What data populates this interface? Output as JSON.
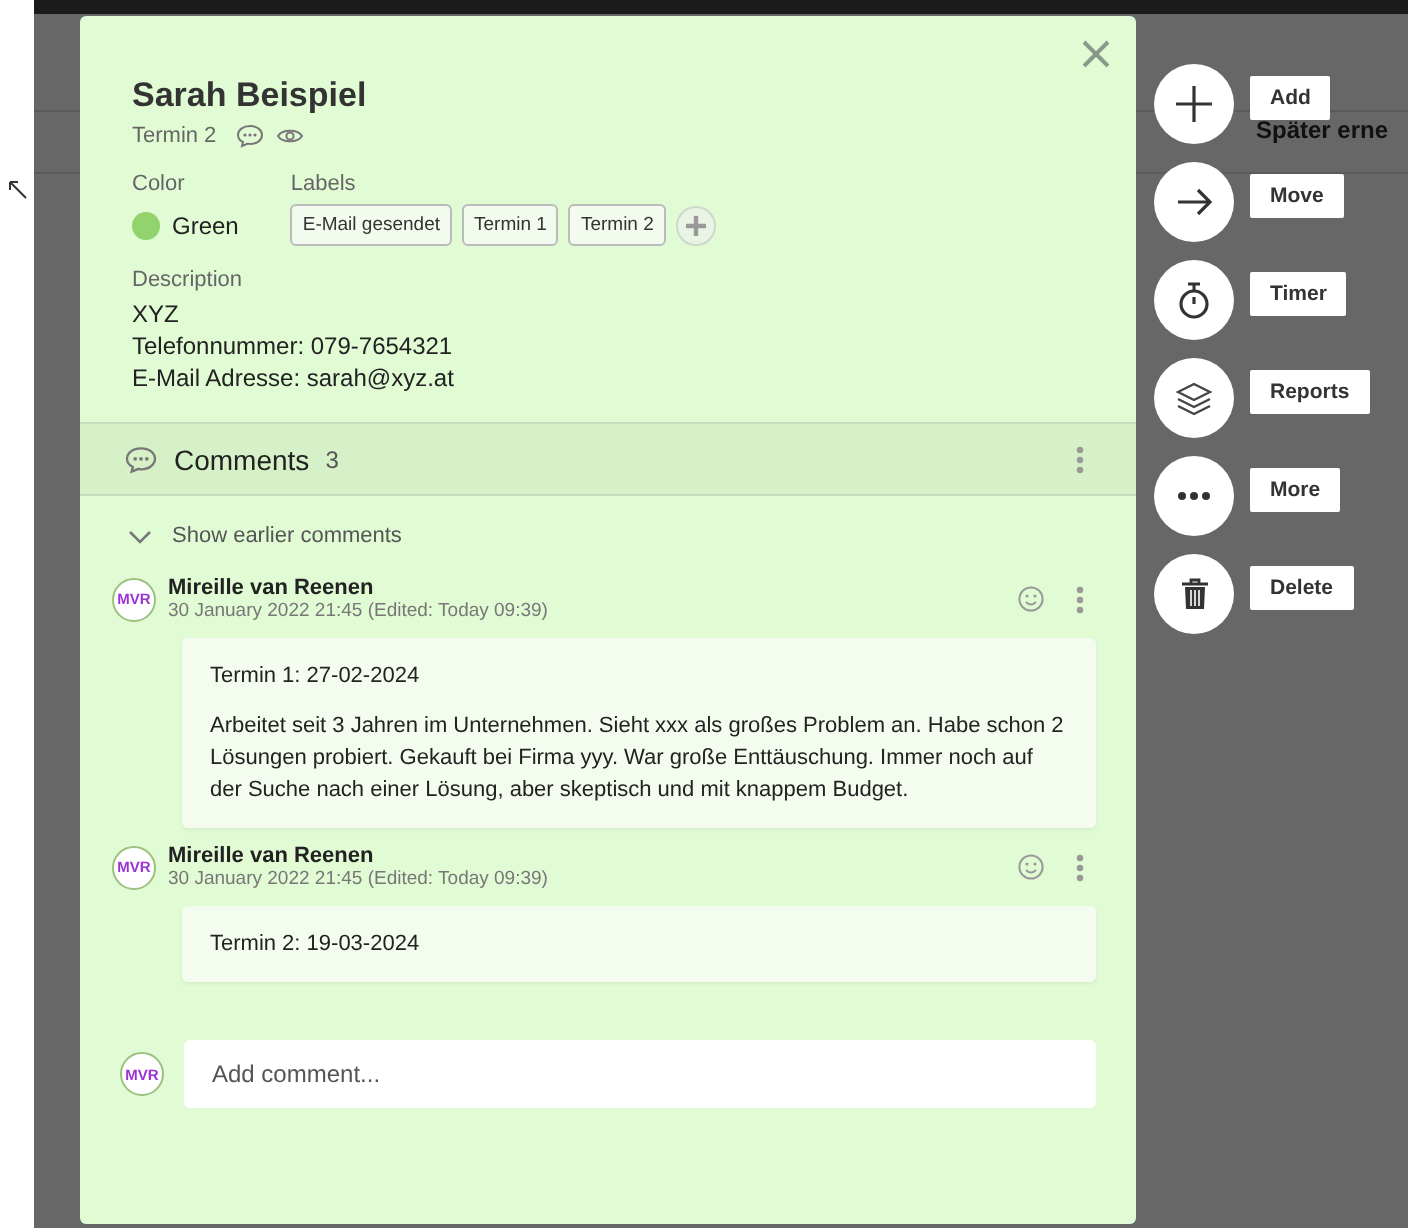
{
  "backdrop": {
    "text": "Später erne"
  },
  "card": {
    "title": "Sarah Beispiel",
    "list": "Termin 2",
    "color_label": "Color",
    "color": {
      "name": "Green",
      "color": "#92d36e"
    },
    "labels_label": "Labels",
    "labels": [
      "E-Mail gesendet",
      "Termin 1",
      "Termin 2"
    ],
    "description_label": "Description",
    "description": [
      "XYZ",
      "Telefonnummer: 079-7654321",
      "E-Mail Adresse: sarah@xyz.at"
    ]
  },
  "comments": {
    "title": "Comments",
    "count": "3",
    "show_earlier": "Show earlier comments",
    "items": [
      {
        "avatar": "MVR",
        "author": "Mireille van Reenen",
        "date": "30 January 2022 21:45 (Edited: Today 09:39)",
        "paragraphs": [
          "Termin 1: 27-02-2024",
          "Arbeitet seit 3 Jahren im Unternehmen. Sieht xxx als großes Problem an. Habe schon 2 Lösungen probiert. Gekauft bei Firma yyy. War große Enttäuschung. Immer noch auf der Suche nach einer Lösung, aber skeptisch und mit knappem Budget."
        ]
      },
      {
        "avatar": "MVR",
        "author": "Mireille van Reenen",
        "date": "30 January 2022 21:45 (Edited: Today 09:39)",
        "paragraphs": [
          "Termin 2: 19-03-2024"
        ]
      }
    ],
    "input": {
      "avatar": "MVR",
      "placeholder": "Add comment..."
    }
  },
  "actions": [
    {
      "kind": "add",
      "label": "Add"
    },
    {
      "kind": "move",
      "label": "Move"
    },
    {
      "kind": "timer",
      "label": "Timer"
    },
    {
      "kind": "reports",
      "label": "Reports"
    },
    {
      "kind": "more",
      "label": "More"
    },
    {
      "kind": "delete",
      "label": "Delete"
    }
  ]
}
